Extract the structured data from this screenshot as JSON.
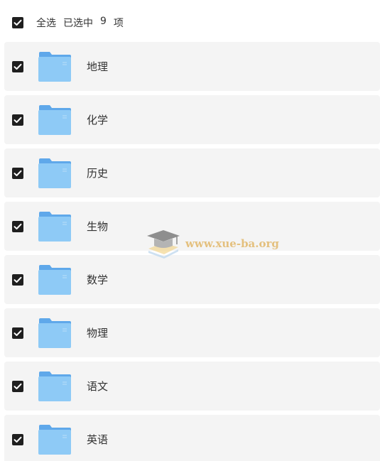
{
  "header": {
    "select_all_label": "全选",
    "selected_prefix": "已选中",
    "selected_count": "9",
    "selected_suffix": "项"
  },
  "folders": [
    {
      "label": "地理"
    },
    {
      "label": "化学"
    },
    {
      "label": "历史"
    },
    {
      "label": "生物"
    },
    {
      "label": "数学"
    },
    {
      "label": "物理"
    },
    {
      "label": "语文"
    },
    {
      "label": "英语"
    }
  ],
  "watermark": {
    "text": "www.xue-ba.org",
    "icon": "graduation-cap-icon"
  },
  "colors": {
    "checkbox": "#1f1f1f",
    "row_background": "#f4f4f4",
    "folder_blue": "#7ec0f2",
    "watermark_text": "#e2b86a"
  }
}
